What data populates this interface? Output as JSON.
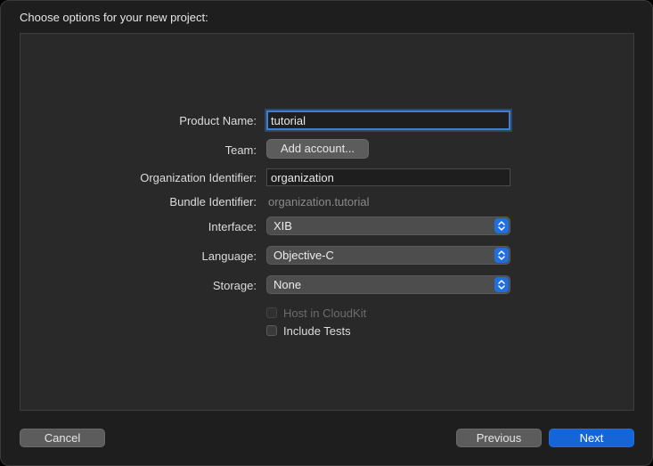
{
  "window": {
    "title": "Choose options for your new project:"
  },
  "form": {
    "product_name": {
      "label": "Product Name:",
      "value": "tutorial"
    },
    "team": {
      "label": "Team:",
      "button": "Add account..."
    },
    "organization_identifier": {
      "label": "Organization Identifier:",
      "value": "organization"
    },
    "bundle_identifier": {
      "label": "Bundle Identifier:",
      "value": "organization.tutorial"
    },
    "interface": {
      "label": "Interface:",
      "value": "XIB"
    },
    "language": {
      "label": "Language:",
      "value": "Objective-C"
    },
    "storage": {
      "label": "Storage:",
      "value": "None"
    },
    "host_in_cloudkit": {
      "label": "Host in CloudKit",
      "checked": false,
      "enabled": false
    },
    "include_tests": {
      "label": "Include Tests",
      "checked": false,
      "enabled": true
    }
  },
  "footer": {
    "cancel": "Cancel",
    "previous": "Previous",
    "next": "Next"
  },
  "colors": {
    "window_bg": "#1e1e1e",
    "panel_bg": "#292929",
    "accent": "#1565d6",
    "focus_ring": "#3d7fd6"
  }
}
